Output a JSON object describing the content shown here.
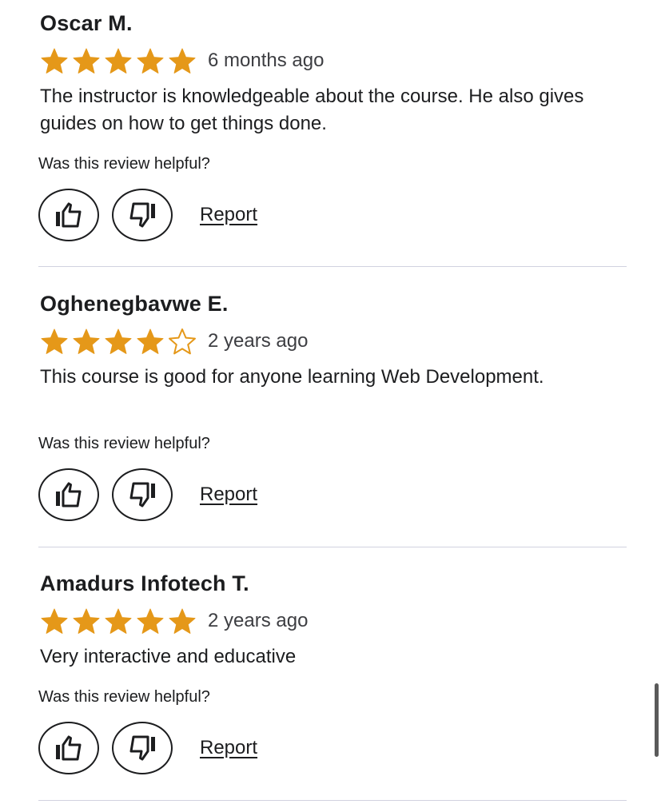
{
  "reviews": [
    {
      "name": "Oscar M.",
      "rating": 5,
      "date": "6 months ago",
      "body": "The instructor is knowledgeable about the course. He also gives guides on how to get things done.",
      "helpful_label": "Was this review helpful?",
      "report_label": "Report"
    },
    {
      "name": "Oghenegbavwe E.",
      "rating": 4,
      "date": "2 years ago",
      "body": "This course is good for anyone learning Web Development.",
      "helpful_label": "Was this review helpful?",
      "report_label": "Report"
    },
    {
      "name": "Amadurs Infotech T.",
      "rating": 5,
      "date": "2 years ago",
      "body": "Very interactive and educative",
      "helpful_label": "Was this review helpful?",
      "report_label": "Report"
    }
  ],
  "colors": {
    "star": "#e59819",
    "text": "#1c1d1f",
    "divider": "#d1d2e0"
  },
  "icons": {
    "helpful": "thumbs-up-icon",
    "not_helpful": "thumbs-down-icon",
    "star": "star-icon"
  }
}
